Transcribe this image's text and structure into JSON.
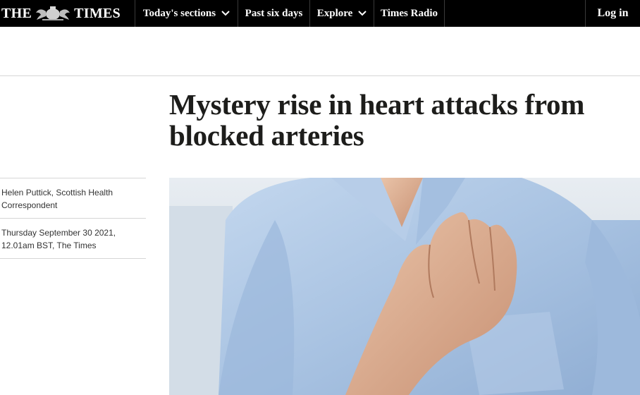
{
  "header": {
    "logo_left": "THE",
    "logo_right": "TIMES",
    "nav": {
      "sections": "Today's sections",
      "past_six_days": "Past six days",
      "explore": "Explore",
      "times_radio": "Times Radio",
      "login": "Log in"
    },
    "colors": {
      "bar": "#000000",
      "text": "#ffffff"
    }
  },
  "article": {
    "headline": "Mystery rise in heart attacks from blocked arteries",
    "author": "Helen Puttick, Scottish Health Correspondent",
    "dateline": "Thursday September 30 2021, 12.01am BST, The Times",
    "hero_image": "photo of a person in a light blue shirt clutching their chest"
  }
}
